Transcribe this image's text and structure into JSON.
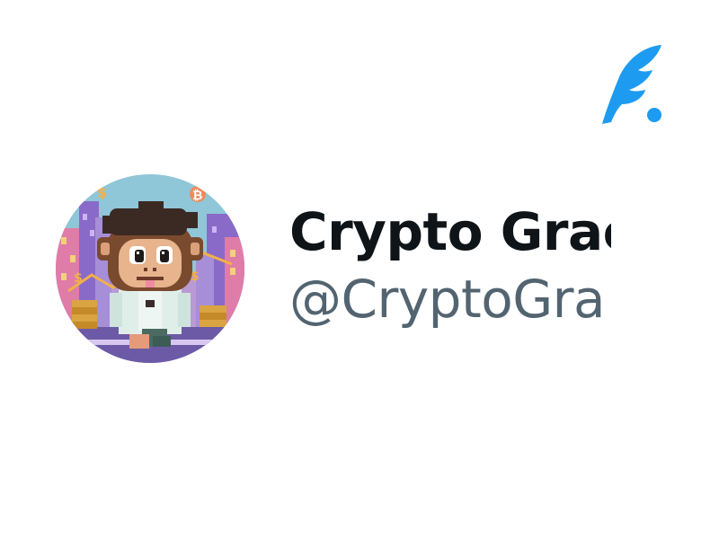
{
  "brand": {
    "logo_icon": "quill-icon",
    "color": "#1d9bf0"
  },
  "profile": {
    "display_name": "Crypto Grac",
    "handle": "@CryptoGra",
    "avatar": {
      "icon": "pixel-art-monkey-avatar",
      "signs": [
        "$",
        "₿",
        "$",
        "$"
      ]
    },
    "colors": {
      "name": "#0f1419",
      "handle": "#536471"
    }
  }
}
